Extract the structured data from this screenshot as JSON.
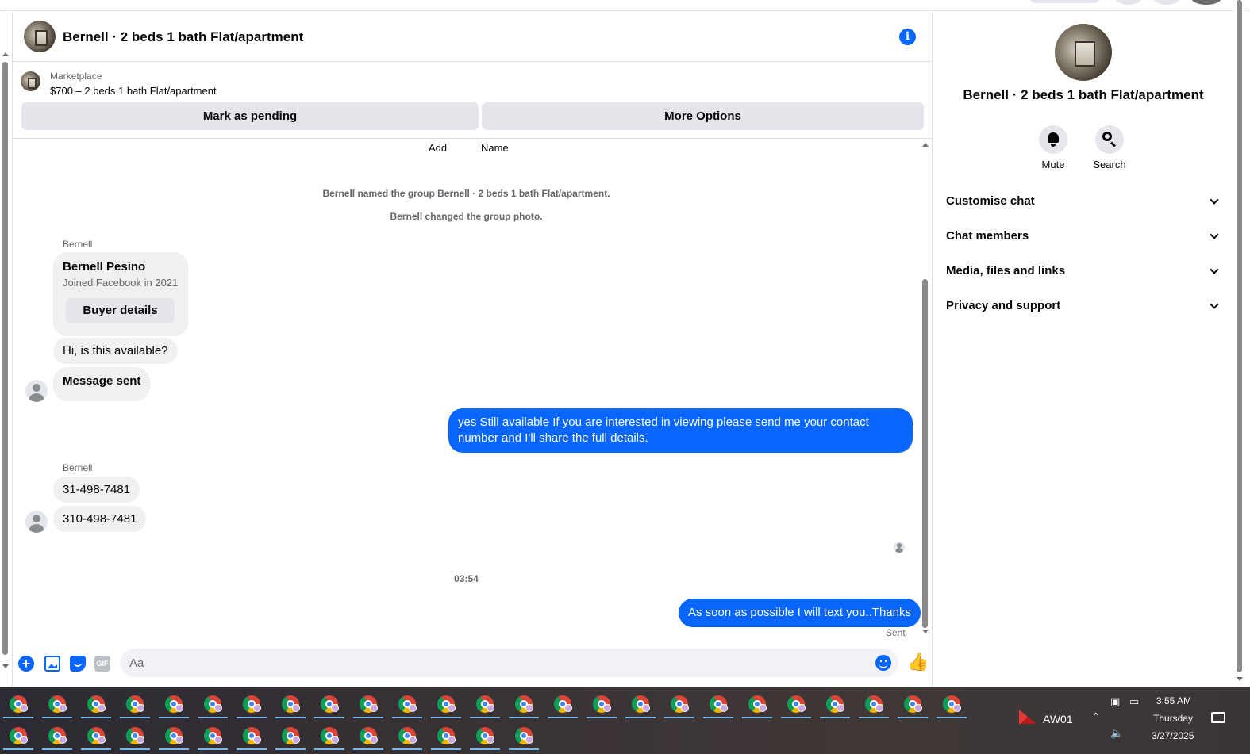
{
  "header": {
    "title": "Bernell · 2 beds 1 bath Flat/apartment",
    "info_icon": "info-icon"
  },
  "marketplace": {
    "label": "Marketplace",
    "item": "$700 – 2 beds 1 bath Flat/apartment",
    "mark_pending_label": "Mark as pending",
    "more_options_label": "More Options"
  },
  "group_actions": {
    "add_label": "Add",
    "name_label": "Name"
  },
  "messages": {
    "system_1": "Bernell named the group Bernell · 2 beds 1 bath Flat/apartment.",
    "system_2": "Bernell changed the group photo.",
    "sender_1": "Bernell",
    "card_name": "Bernell Pesino",
    "card_sub": "Joined Facebook in 2021",
    "card_button": "Buyer details",
    "in_1": "Hi, is this available?",
    "in_2": "Message sent",
    "out_1": "yes Still available If you are interested in viewing please send me your contact number and I'll share the full details.",
    "sender_2": "Bernell",
    "in_3": "31-498-7481",
    "in_4": "310-498-7481",
    "timestamp": "03:54",
    "out_2": "As soon as possible I will text you..Thanks",
    "status": "Sent"
  },
  "composer": {
    "placeholder": "Aa",
    "icons": [
      "plus-icon",
      "photo-icon",
      "sticker-icon",
      "gif-icon",
      "emoji-icon",
      "like-icon"
    ],
    "gif_text": "GIF"
  },
  "info_panel": {
    "title": "Bernell · 2 beds 1 bath Flat/apartment",
    "mute_label": "Mute",
    "search_label": "Search",
    "sections": [
      "Customise chat",
      "Chat members",
      "Media, files and links",
      "Privacy and support"
    ]
  },
  "taskbar": {
    "app_label": "AW01",
    "time": "3:55 AM",
    "day": "Thursday",
    "date": "3/27/2025"
  },
  "colors": {
    "accent": "#0866ff",
    "bubble_in": "#f0f0f0",
    "button_bg": "#e4e6eb"
  }
}
